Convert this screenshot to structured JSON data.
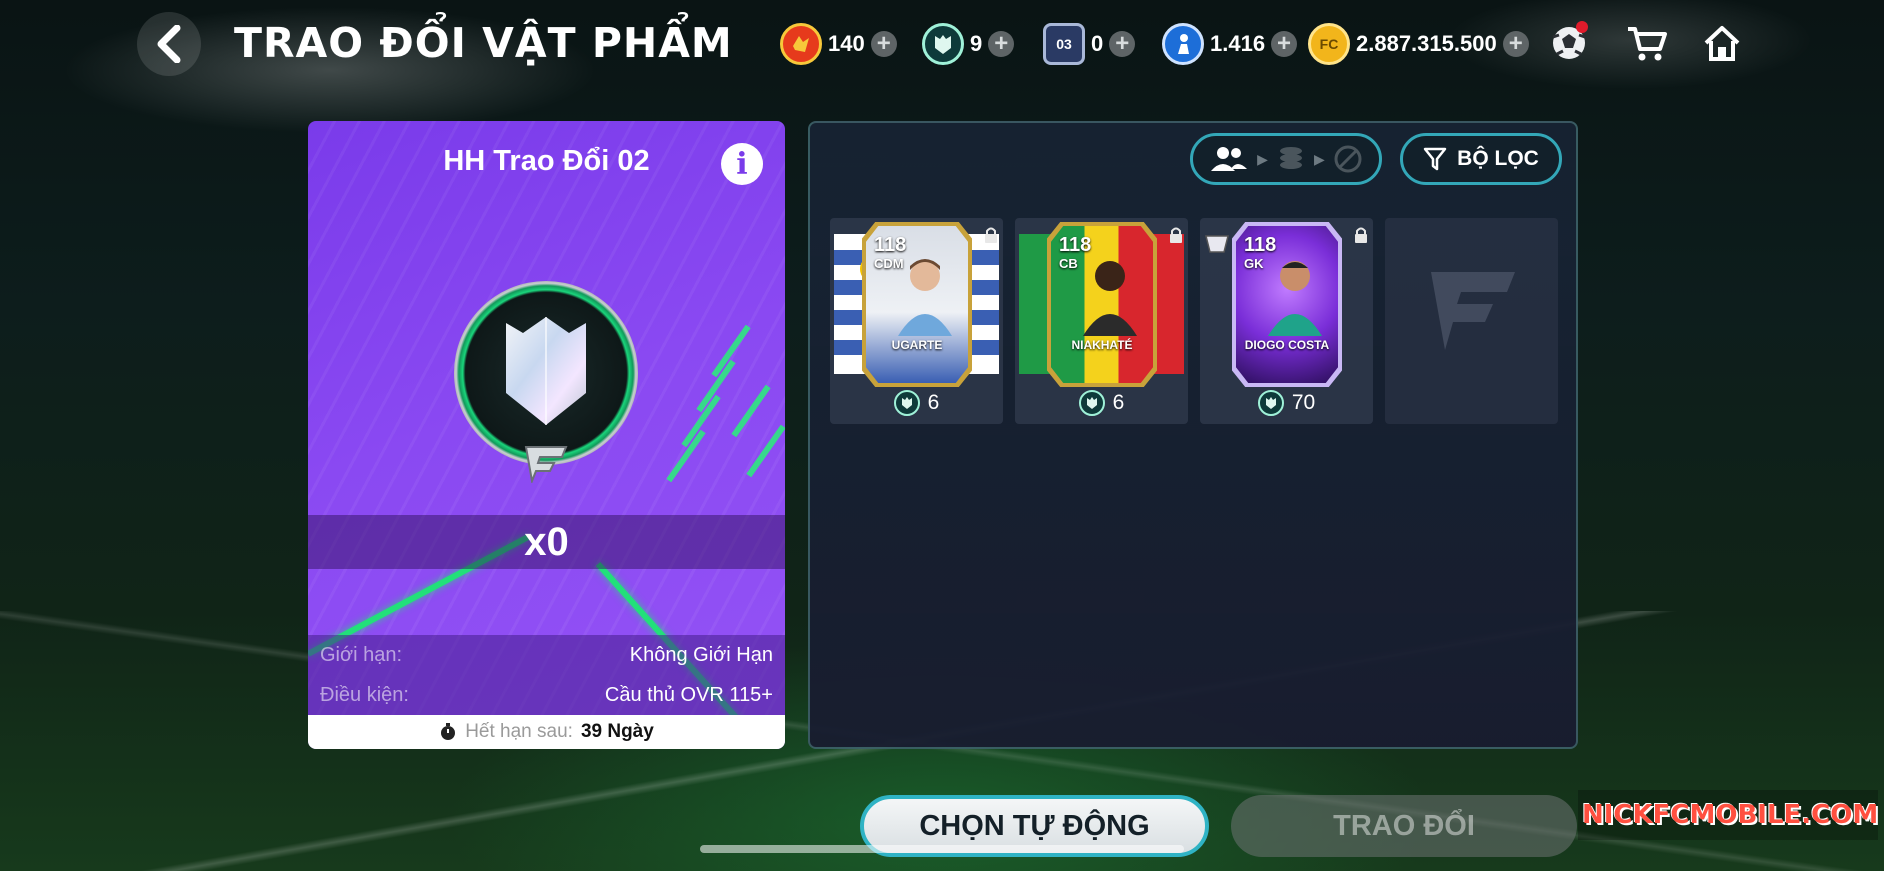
{
  "header": {
    "title": "TRAO ĐỔI VẬT PHẨM",
    "currencies": [
      {
        "name": "red-token",
        "value": "140",
        "color": "#e63a1c"
      },
      {
        "name": "gem",
        "value": "9",
        "color": "#9ff1d8"
      },
      {
        "name": "ticket",
        "value": "0",
        "badge": "03",
        "color": "#2a3a64"
      },
      {
        "name": "player-coin",
        "value": "1.416",
        "color": "#1d6ed8"
      },
      {
        "name": "fc-coin",
        "value": "2.887.315.500",
        "color": "#f2b51b"
      }
    ]
  },
  "exchange": {
    "title": "HH Trao Đổi 02",
    "count": "x0",
    "limit_label": "Giới hạn:",
    "limit_value": "Không Giới Hạn",
    "condition_label": "Điều kiện:",
    "condition_value": "Cầu thủ OVR 115+",
    "expiry_label": "Hết hạn sau:",
    "expiry_value": "39 Ngày"
  },
  "toolbar": {
    "filter_label": "BỘ LỌC"
  },
  "players": [
    {
      "ovr": "118",
      "position": "CDM",
      "name": "UGARTE",
      "cost": "6",
      "card": "gold",
      "flag": "uruguay"
    },
    {
      "ovr": "118",
      "position": "CB",
      "name": "NIAKHATÉ",
      "cost": "6",
      "card": "gold",
      "flag": "mali"
    },
    {
      "ovr": "118",
      "position": "GK",
      "name": "DIOGO COSTA",
      "cost": "70",
      "card": "purple",
      "flag": "none"
    }
  ],
  "buttons": {
    "auto": "CHỌN TỰ ĐỘNG",
    "trade": "TRAO ĐỔI"
  },
  "watermark": "NICKFCMOBILE.COM"
}
